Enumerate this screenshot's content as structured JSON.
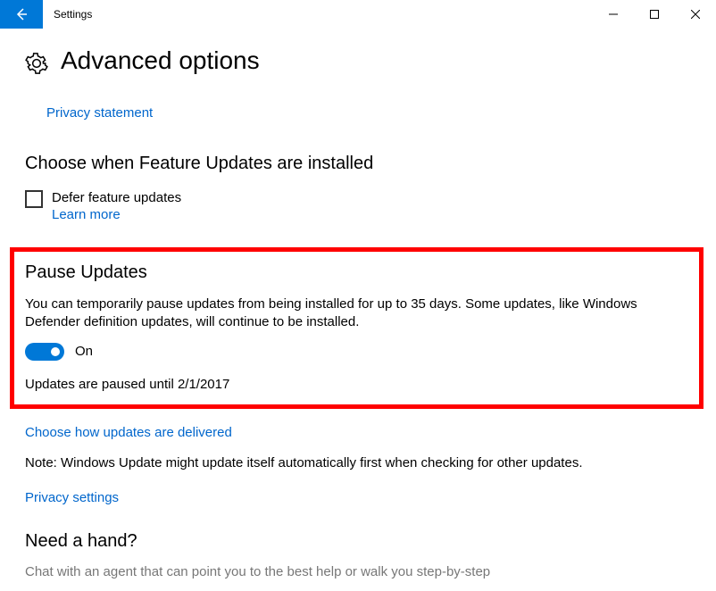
{
  "window": {
    "title": "Settings"
  },
  "header": {
    "page_title": "Advanced options"
  },
  "links": {
    "privacy_statement": "Privacy statement",
    "learn_more": "Learn more",
    "choose_delivery": "Choose how updates are delivered",
    "privacy_settings": "Privacy settings"
  },
  "sections": {
    "choose_when": {
      "heading": "Choose when Feature Updates are installed",
      "defer_label": "Defer feature updates"
    },
    "pause": {
      "heading": "Pause Updates",
      "description": "You can temporarily pause updates from being installed for up to 35 days. Some updates, like Windows Defender definition updates, will continue to be installed.",
      "toggle_state": "On",
      "status": "Updates are paused until 2/1/2017"
    },
    "note": "Note: Windows Update might update itself automatically first when checking for other updates.",
    "need_hand": {
      "heading": "Need a hand?",
      "chat": "Chat with an agent that can point you to the best help or walk you step-by-step"
    }
  }
}
